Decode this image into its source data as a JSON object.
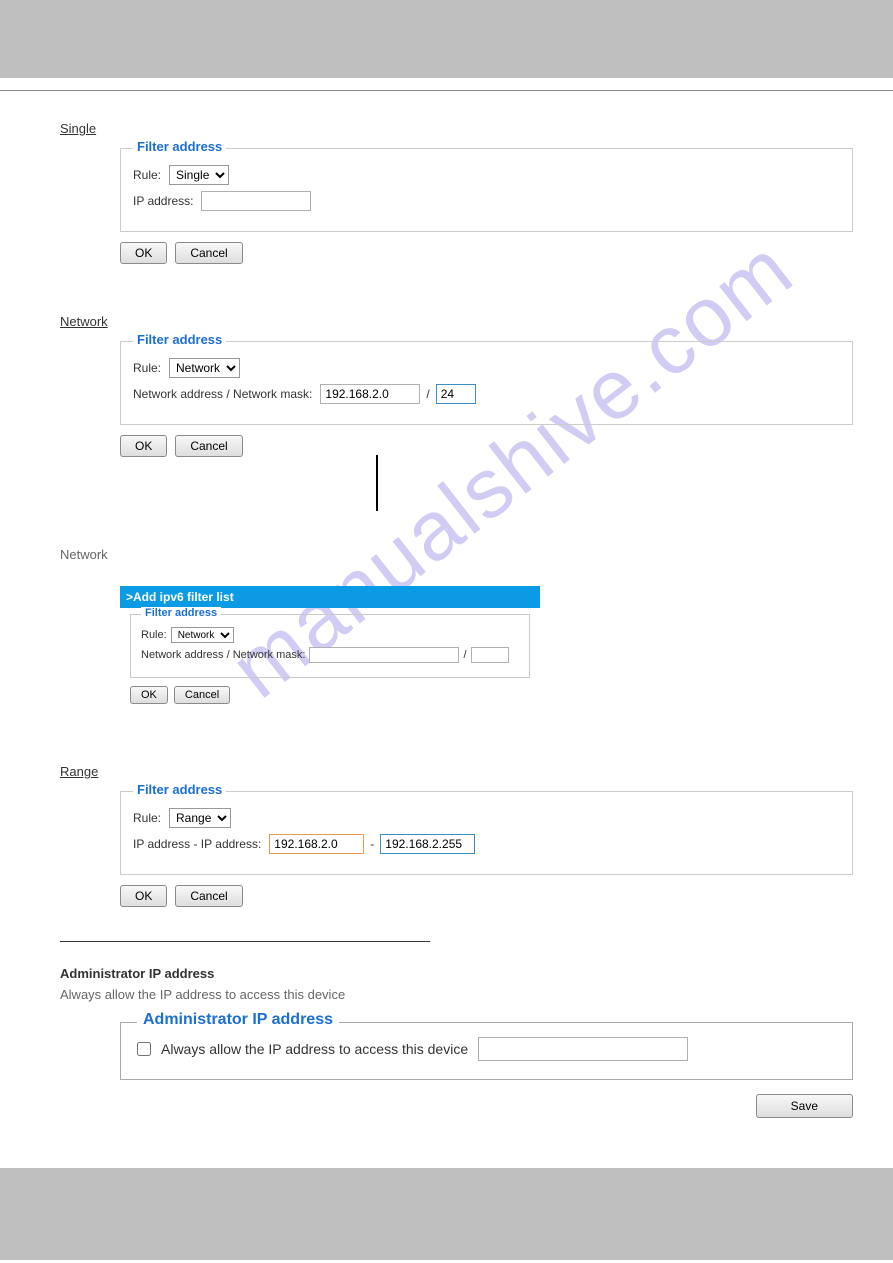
{
  "watermark": "manualshive.com",
  "labels": {
    "single": "Single",
    "network": "Network",
    "network_ipv6": "Network",
    "range": "Range"
  },
  "panels": {
    "filter_title": "Filter address",
    "rule_label": "Rule:",
    "ip_label": "IP address:",
    "netmask_label": "Network address / Network mask:",
    "range_label": "IP address - IP address:"
  },
  "single": {
    "rule": "Single",
    "ip": ""
  },
  "network": {
    "rule": "Network",
    "addr": "192.168.2.0",
    "mask": "24",
    "sep": "/"
  },
  "ipv6": {
    "titlebar": ">Add ipv6 filter list",
    "rule": "Network",
    "addr": "",
    "mask": "",
    "sep": "/"
  },
  "range": {
    "rule": "Range",
    "from": "192.168.2.0",
    "to": "192.168.2.255",
    "sep": "-"
  },
  "buttons": {
    "ok": "OK",
    "cancel": "Cancel",
    "save": "Save"
  },
  "text": {
    "admin_ip_heading": "Administrator IP address",
    "admin_ip_title": "Administrator IP address",
    "admin_ip_check_label": "Always allow the IP address to access this device",
    "intro": "Always allow the IP address to access this device"
  }
}
